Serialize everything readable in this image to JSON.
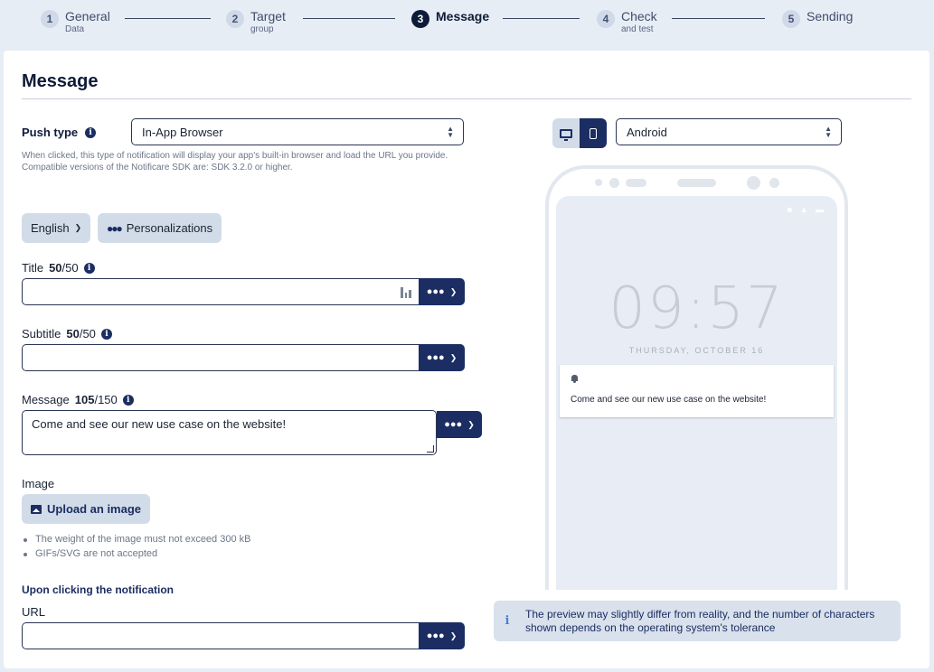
{
  "stepper": {
    "steps": [
      {
        "num": "1",
        "label": "General",
        "sub": "Data"
      },
      {
        "num": "2",
        "label": "Target",
        "sub": "group"
      },
      {
        "num": "3",
        "label": "Message",
        "sub": ""
      },
      {
        "num": "4",
        "label": "Check",
        "sub": "and test"
      },
      {
        "num": "5",
        "label": "Sending",
        "sub": ""
      }
    ],
    "active_step": "3"
  },
  "page": {
    "title": "Message"
  },
  "push_type": {
    "label": "Push type",
    "value": "In-App Browser",
    "help": "When clicked, this type of notification will display your app's built-in browser and load the URL you provide. Compatible versions of the Notificare SDK are: SDK 3.2.0 or higher."
  },
  "language": {
    "value": "English"
  },
  "personalizations": {
    "label": "Personalizations"
  },
  "title_field": {
    "label": "Title",
    "count": "50",
    "max": "/50",
    "value": ""
  },
  "subtitle_field": {
    "label": "Subtitle",
    "count": "50",
    "max": "/50",
    "value": ""
  },
  "message_field": {
    "label": "Message",
    "count": "105",
    "max": "/150",
    "value": "Come and see our new use case on the website!"
  },
  "image": {
    "label": "Image",
    "upload_label": "Upload an image",
    "rules": [
      "The weight of the image must not exceed 300 kB",
      "GIFs/SVG are not accepted"
    ]
  },
  "click_action": {
    "title": "Upon clicking the notification",
    "url_label": "URL",
    "url_value": ""
  },
  "preview": {
    "platform": "Android",
    "time": "09:57",
    "date": "THURSDAY, OCTOBER 16",
    "notification_text": "Come and see our new use case on the website!",
    "note": "The preview may slightly differ from reality, and the number of characters shown depends on the operating system's tolerance"
  },
  "icons": {
    "info": "info-icon",
    "people": "people-icon",
    "chevron": "chevron-down-icon",
    "emoji": "emoji-icon",
    "image": "image-icon",
    "desktop": "desktop-icon",
    "mobile": "mobile-icon",
    "bell": "bell-icon"
  },
  "colors": {
    "primary": "#1b2d63",
    "accent_bg": "#d2dce8",
    "page_bg": "#e7edf5"
  }
}
